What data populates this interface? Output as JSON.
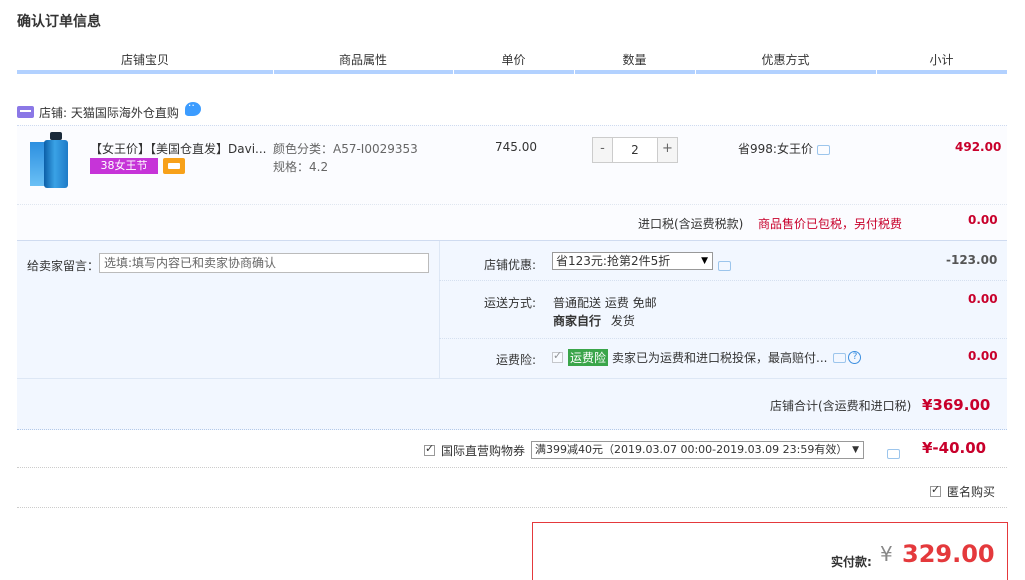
{
  "page_title": "确认订单信息",
  "table_headers": [
    "店铺宝贝",
    "商品属性",
    "单价",
    "数量",
    "优惠方式",
    "小计"
  ],
  "store": {
    "label": "店铺: 天猫国际海外仓直购"
  },
  "item": {
    "title": "【女王价】【美国仓直发】Davi...",
    "badge": "38女王节",
    "attr_color": "颜色分类：A57-I0029353",
    "attr_spec": "规格：4.2",
    "unit_price": "745.00",
    "qty_minus": "-",
    "qty_value": "2",
    "qty_plus": "+",
    "promo": "省998:女王价",
    "subtotal": "492.00"
  },
  "tax": {
    "label": "进口税(含运费税款)",
    "note": "商品售价已包税，另付税费",
    "value": "0.00"
  },
  "seller_message": {
    "label": "给卖家留言：",
    "placeholder": "选填:填写内容已和卖家协商确认"
  },
  "store_discount": {
    "label": "店铺优惠:",
    "selected": "省123元:抢第2件5折",
    "value": "-123.00"
  },
  "shipping": {
    "label": "运送方式:",
    "line1": "普通配送 运费 免邮",
    "line2_bold": "商家自行",
    "line2_rest": "发货",
    "value": "0.00"
  },
  "insurance": {
    "label": "运费险:",
    "tag": "运费险",
    "text": "卖家已为运费和进口税投保，最高赔付...",
    "help": "?",
    "value": "0.00"
  },
  "store_total": {
    "label": "店铺合计(含运费和进口税)",
    "value": "¥369.00"
  },
  "coupon": {
    "label": "国际直营购物券",
    "selected": "满399减40元（2019.03.07 00:00-2019.03.09 23:59有效）",
    "value": "¥-40.00"
  },
  "anonymous": {
    "label": "匿名购买"
  },
  "payment": {
    "label": "实付款:",
    "yen": "¥",
    "value": "329.00"
  },
  "colors": {
    "accent_red": "#c8002b",
    "header_line": "#b2d1ff",
    "panel_bg": "#f2f7ff",
    "badge_purple": "#c634d8",
    "tag_green": "#3aa54a"
  }
}
